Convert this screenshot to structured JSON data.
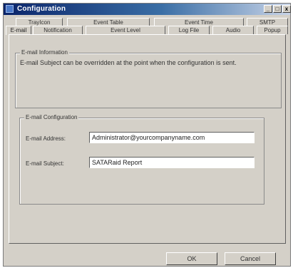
{
  "window": {
    "title": "Configuration",
    "controls": {
      "minimize": "_",
      "maximize": "□",
      "close": "x"
    }
  },
  "tabs": {
    "top_row": [
      "TrayIcon",
      "Event Table",
      "Event Time",
      "SMTP"
    ],
    "bottom_row": [
      "E-mail",
      "Notification",
      "Event Level",
      "Log File",
      "Audio",
      "Popup"
    ],
    "active": "E-mail"
  },
  "email_info": {
    "legend": "E-mail Information",
    "text": "E-mail Subject can be overridden at the point when the configuration is sent."
  },
  "email_config": {
    "legend": "E-mail Configuration",
    "address_label": "E-mail Address:",
    "address_value": "Administrator@yourcompanyname.com",
    "subject_label": "E-mail Subject:",
    "subject_value": "SATARaid Report"
  },
  "buttons": {
    "ok": "OK",
    "cancel": "Cancel"
  }
}
